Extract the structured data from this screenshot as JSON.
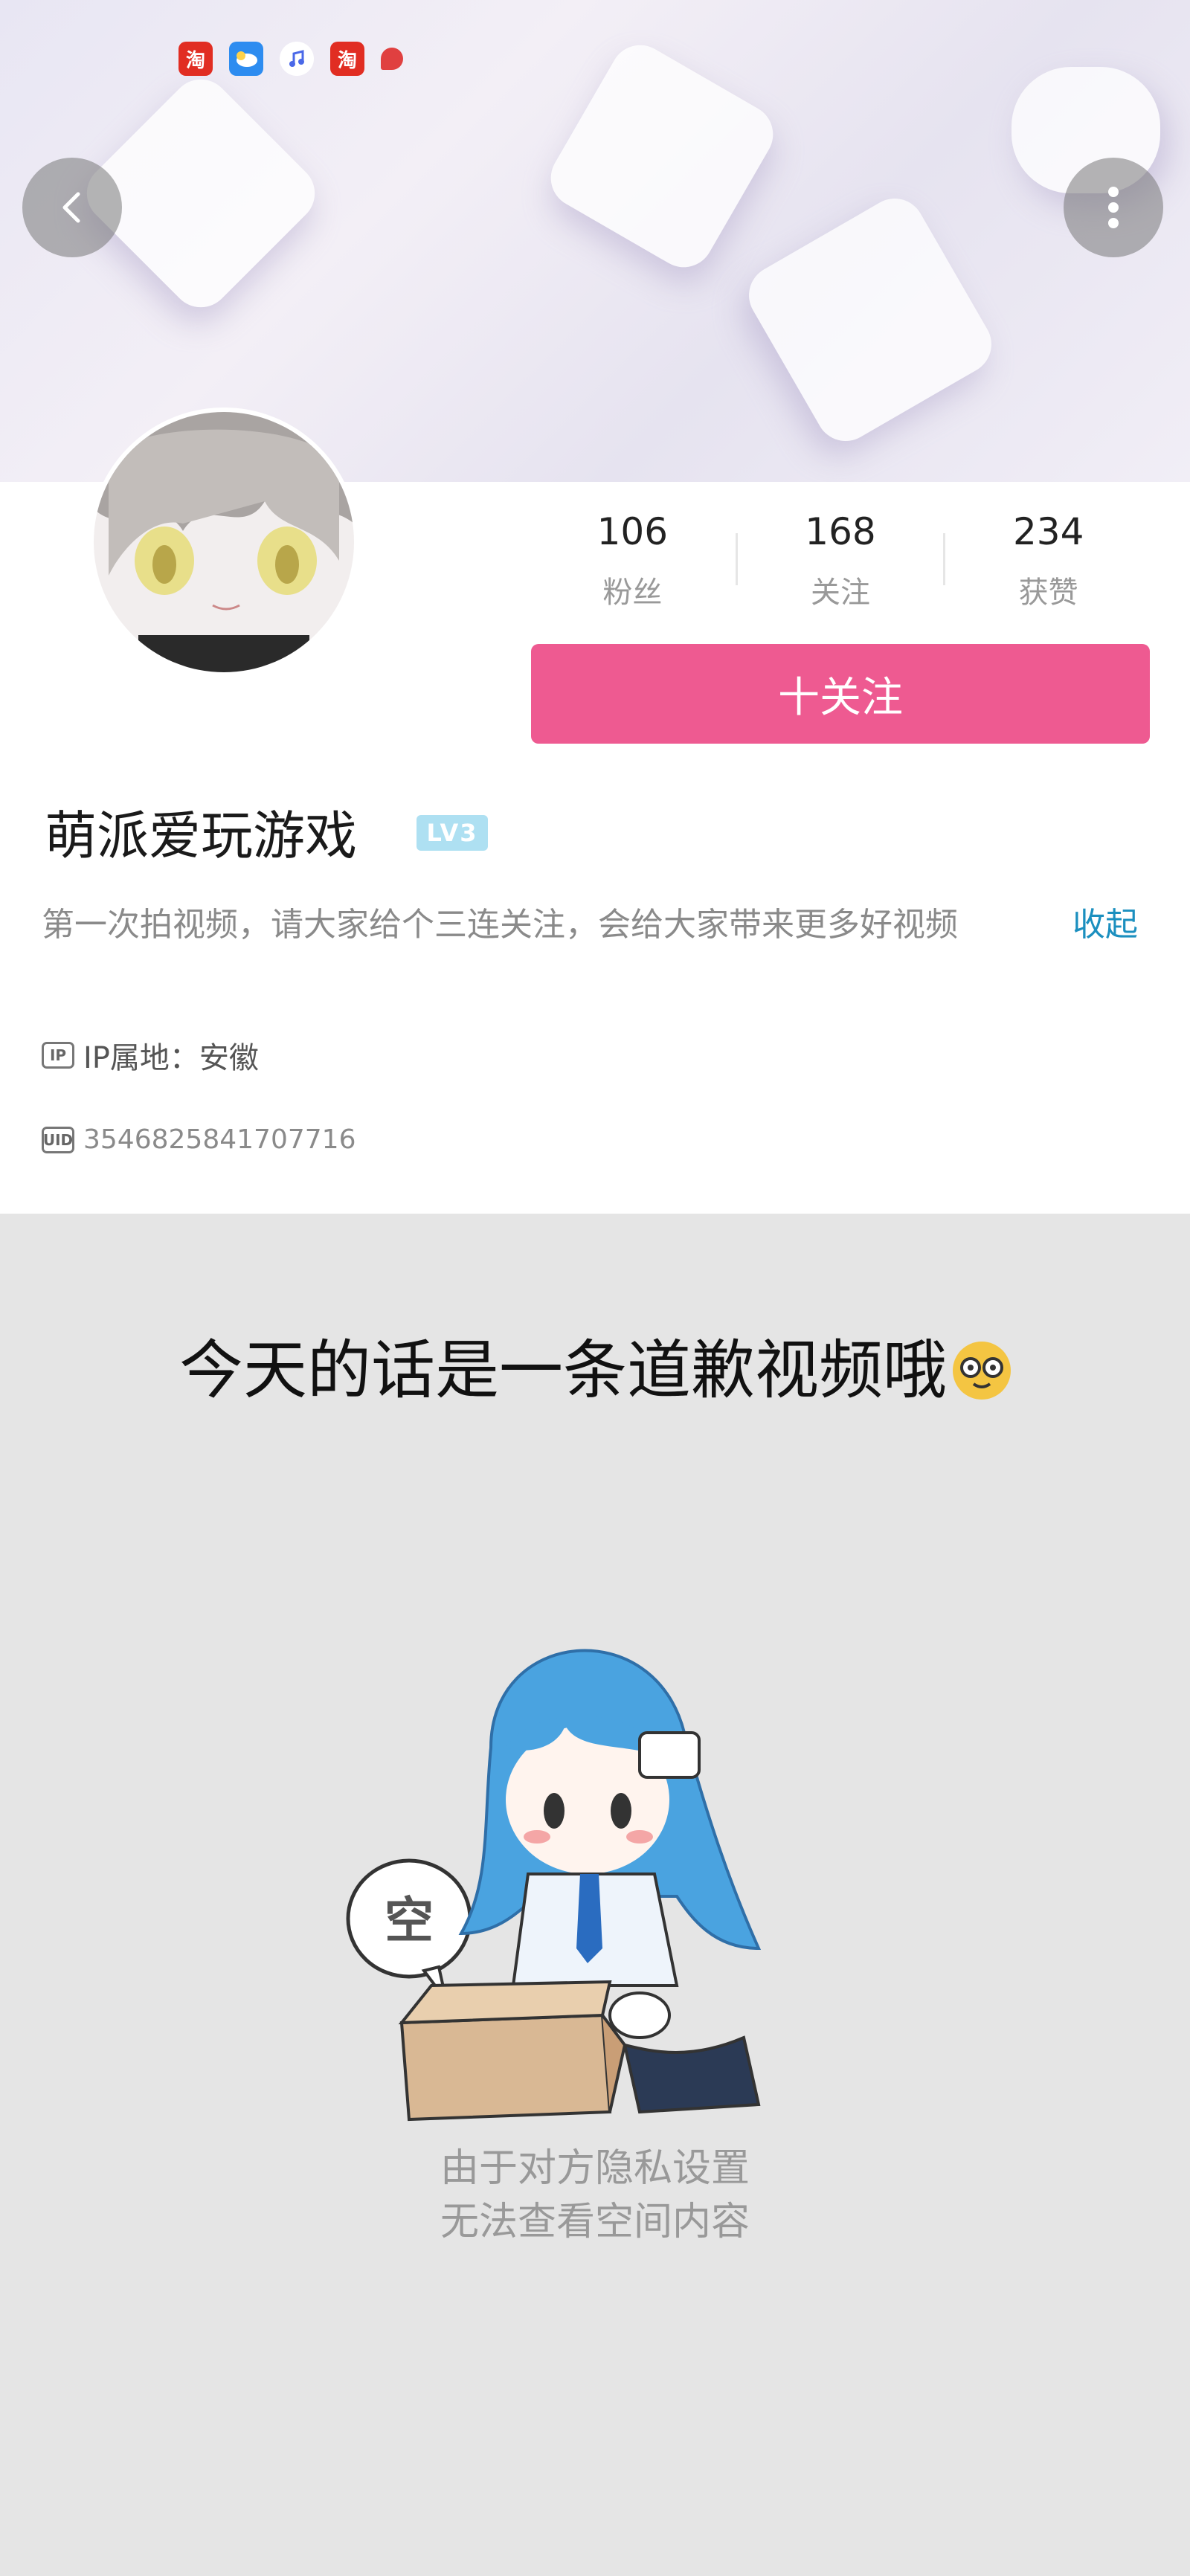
{
  "status_bar": {
    "icons": [
      "taobao-icon",
      "weather-icon",
      "music-icon",
      "taobao-icon",
      "notification-icon"
    ],
    "taobao_glyph": "淘"
  },
  "nav": {
    "back_icon": "chevron-left-icon",
    "more_icon": "more-vertical-icon"
  },
  "profile": {
    "stats": [
      {
        "value": "106",
        "label": "粉丝"
      },
      {
        "value": "168",
        "label": "关注"
      },
      {
        "value": "234",
        "label": "获赞"
      }
    ],
    "follow_label": "十关注",
    "username": "萌派爱玩游戏",
    "level": "LV3",
    "bio": "第一次拍视频，请大家给个三连关注，会给大家带来更多好视频",
    "collapse_label": "收起",
    "ip_label": "IP属地：安徽",
    "uid": "3546825841707716",
    "colors": {
      "accent": "#ee5a91",
      "link": "#1b8fbf"
    }
  },
  "content": {
    "caption": "今天的话是一条道歉视频哦",
    "mascot_bubble": "空",
    "empty_line1": "由于对方隐私设置",
    "empty_line2": "无法查看空间内容"
  }
}
